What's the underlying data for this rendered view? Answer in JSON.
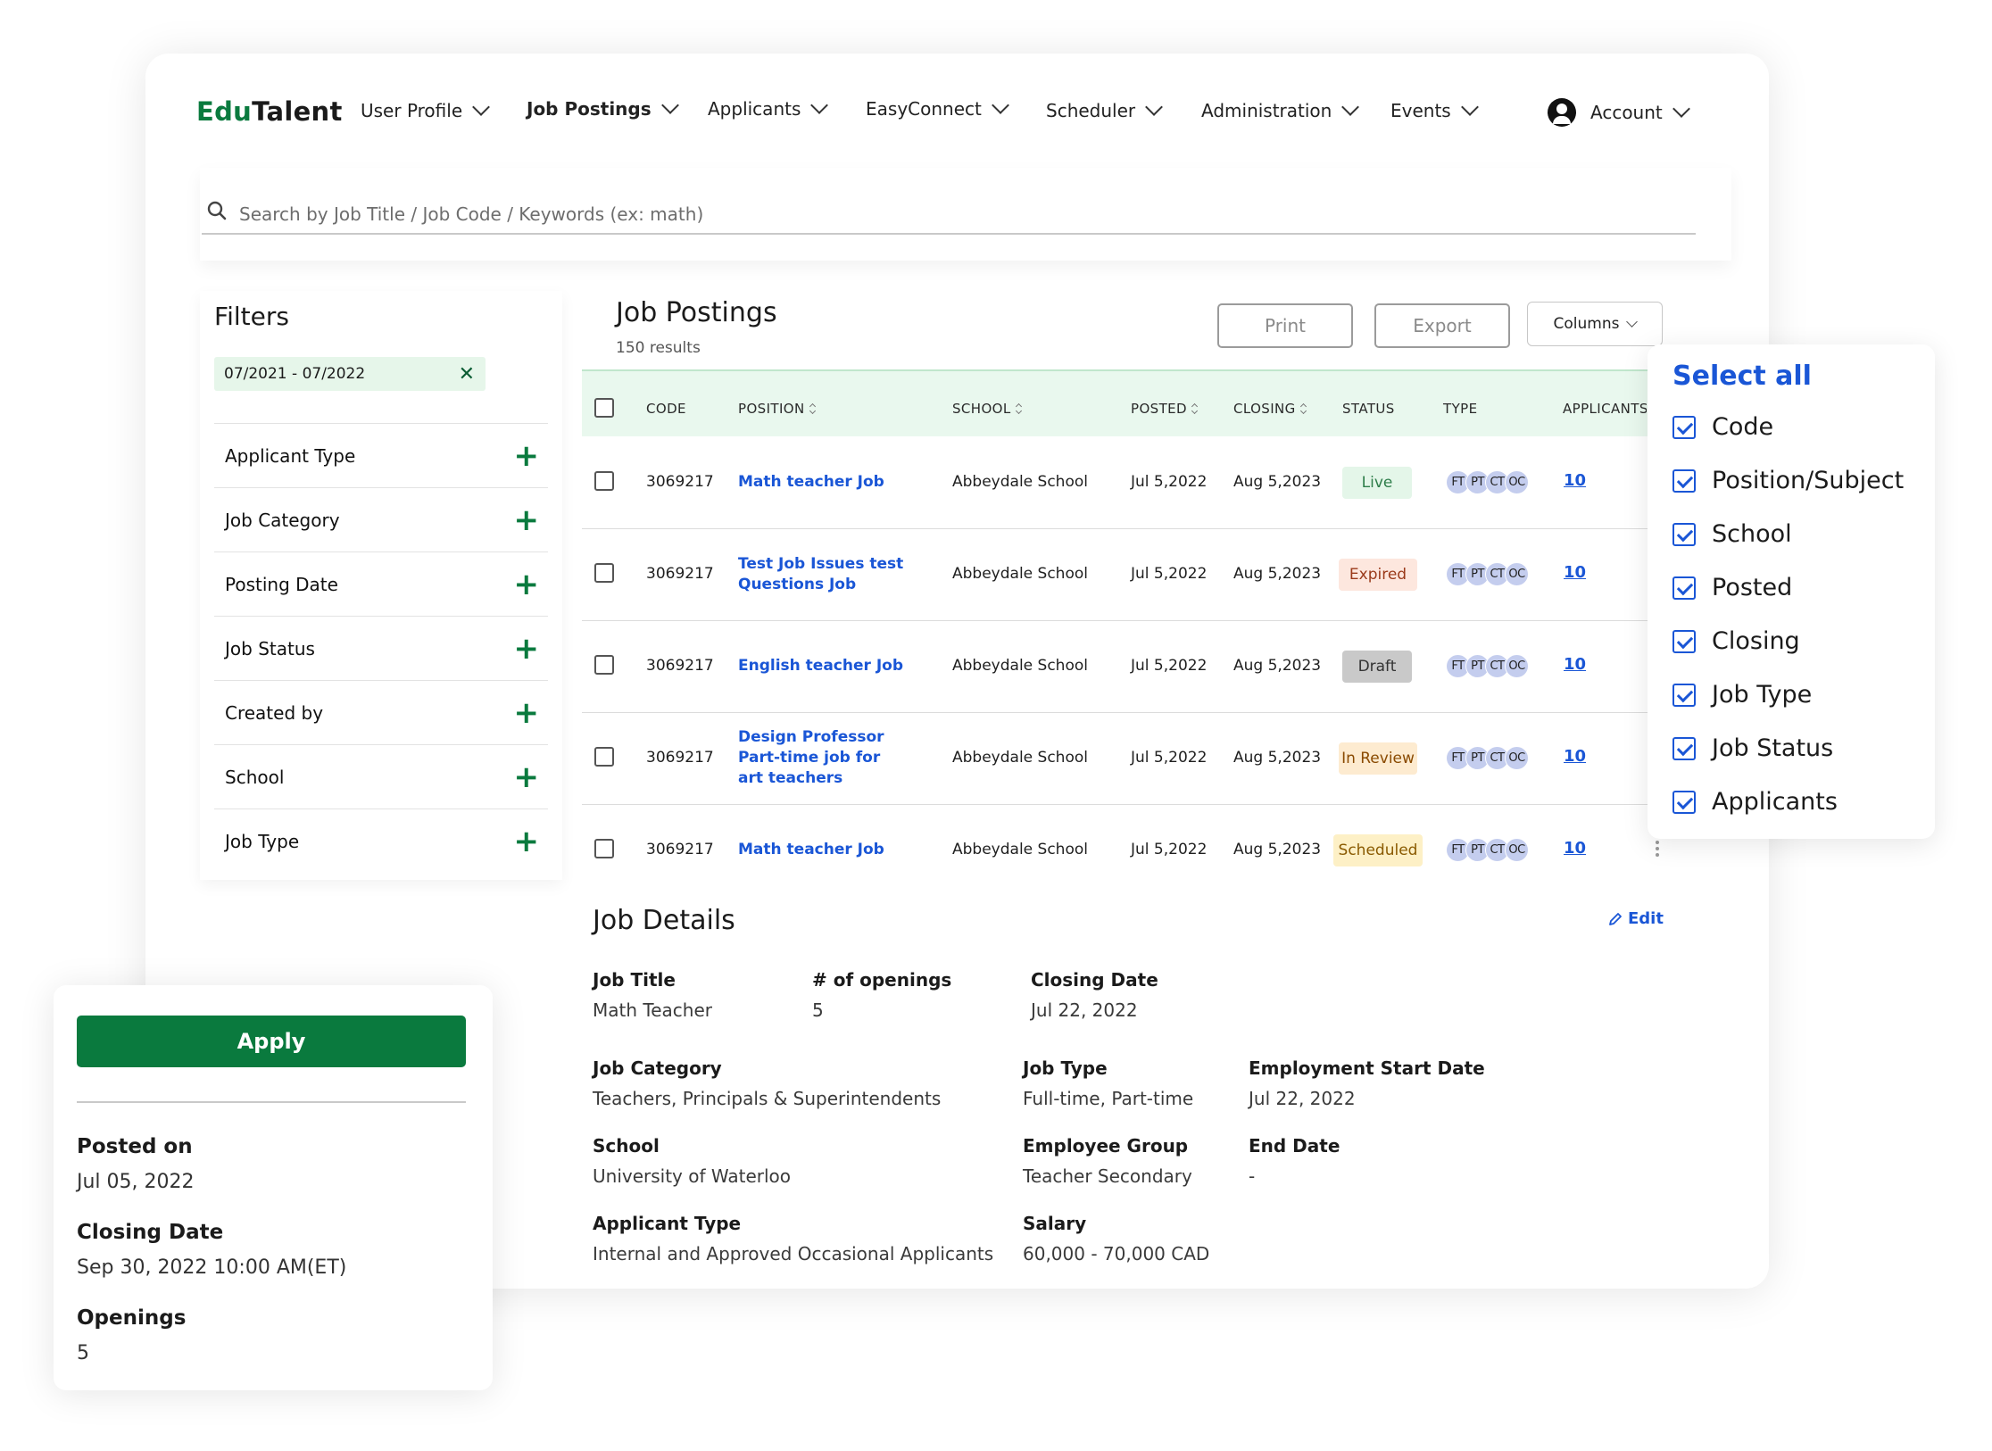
{
  "brand": {
    "part1": "Edu",
    "part2": "Talent"
  },
  "nav": {
    "items": [
      "User Profile",
      "Job Postings",
      "Applicants",
      "EasyConnect",
      "Scheduler",
      "Administration",
      "Events"
    ],
    "account": "Account"
  },
  "search": {
    "placeholder": "Search by Job Title / Job Code / Keywords (ex: math)"
  },
  "filters": {
    "title": "Filters",
    "active_chip": "07/2021 - 07/2022",
    "items": [
      "Applicant Type",
      "Job Category",
      "Posting Date",
      "Job Status",
      "Created by",
      "School",
      "Job Type"
    ]
  },
  "postings": {
    "title": "Job Postings",
    "results": "150 results",
    "print": "Print",
    "export": "Export",
    "columns": "Columns",
    "headers": [
      "CODE",
      "POSITION",
      "SCHOOL",
      "POSTED",
      "CLOSING",
      "STATUS",
      "TYPE",
      "APPLICANTS"
    ],
    "rows": [
      {
        "code": "3069217",
        "position": "Math teacher Job",
        "school": "Abbeydale School",
        "posted": "Jul 5,2022",
        "closing": "Aug 5,2023",
        "status": "Live",
        "types": [
          "FT",
          "PT",
          "CT",
          "OC"
        ],
        "applicants": "10"
      },
      {
        "code": "3069217",
        "position": "Test Job Issues test Questions Job",
        "school": "Abbeydale School",
        "posted": "Jul 5,2022",
        "closing": "Aug 5,2023",
        "status": "Expired",
        "types": [
          "FT",
          "PT",
          "CT",
          "OC"
        ],
        "applicants": "10"
      },
      {
        "code": "3069217",
        "position": "English teacher Job",
        "school": "Abbeydale School",
        "posted": "Jul 5,2022",
        "closing": "Aug 5,2023",
        "status": "Draft",
        "types": [
          "FT",
          "PT",
          "CT",
          "OC"
        ],
        "applicants": "10"
      },
      {
        "code": "3069217",
        "position": "Design Professor Part-time job for art teachers",
        "school": "Abbeydale School",
        "posted": "Jul 5,2022",
        "closing": "Aug 5,2023",
        "status": "In Review",
        "types": [
          "FT",
          "PT",
          "CT",
          "OC"
        ],
        "applicants": "10"
      },
      {
        "code": "3069217",
        "position": "Math teacher Job",
        "school": "Abbeydale School",
        "posted": "Jul 5,2022",
        "closing": "Aug 5,2023",
        "status": "Scheduled",
        "types": [
          "FT",
          "PT",
          "CT",
          "OC"
        ],
        "applicants": "10"
      }
    ],
    "status_colors": {
      "Live": {
        "bg": "#e4f6e9",
        "fg": "#2e7d4a"
      },
      "Expired": {
        "bg": "#fde7de",
        "fg": "#9a3a1a"
      },
      "Draft": {
        "bg": "#c9c9c9",
        "fg": "#333333"
      },
      "In Review": {
        "bg": "#fdebd0",
        "fg": "#8a4a00"
      },
      "Scheduled": {
        "bg": "#fdf0c6",
        "fg": "#8a5a00"
      }
    }
  },
  "columns_panel": {
    "select_all": "Select all",
    "options": [
      "Code",
      "Position/Subject",
      "School",
      "Posted",
      "Closing",
      "Job Type",
      "Job Status",
      "Applicants"
    ]
  },
  "details": {
    "title": "Job Details",
    "edit": "Edit",
    "job_title_label": "Job Title",
    "job_title": "Math Teacher",
    "openings_label": "# of openings",
    "openings": "5",
    "closing_label": "Closing Date",
    "closing": "Jul 22, 2022",
    "category_label": "Job Category",
    "category": "Teachers, Principals & Superintendents",
    "type_label": "Job Type",
    "type": "Full-time, Part-time",
    "start_label": "Employment Start Date",
    "start": "Jul 22, 2022",
    "school_label": "School",
    "school": "University of Waterloo",
    "group_label": "Employee Group",
    "group": "Teacher Secondary",
    "end_label": "End Date",
    "end": "-",
    "applicant_type_label": "Applicant Type",
    "applicant_type": "Internal and Approved Occasional Applicants",
    "salary_label": "Salary",
    "salary": "60,000 - 70,000 CAD"
  },
  "apply_card": {
    "apply": "Apply",
    "posted_label": "Posted on",
    "posted": "Jul 05, 2022",
    "closing_label": "Closing Date",
    "closing": "Sep 30, 2022 10:00 AM(ET)",
    "openings_label": "Openings",
    "openings": "5"
  },
  "colors": {
    "brand_green": "#0a7a3e",
    "link_blue": "#1a56d6",
    "header_green": "#e9f8ee"
  }
}
